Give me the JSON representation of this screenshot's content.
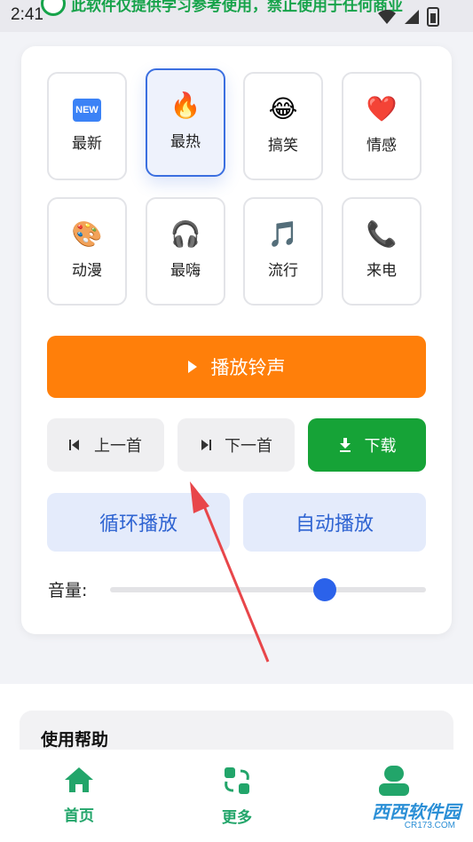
{
  "status_bar": {
    "time": "2:41",
    "notification_text": "此软件仅提供学习参考使用，禁止使用于任何商业"
  },
  "categories": [
    {
      "label": "最新",
      "emoji": "NEW",
      "icon": "new-icon",
      "selected": false
    },
    {
      "label": "最热",
      "emoji": "🔥",
      "icon": "fire-icon",
      "selected": true
    },
    {
      "label": "搞笑",
      "emoji": "😂",
      "icon": "laughing-face-icon",
      "selected": false
    },
    {
      "label": "情感",
      "emoji": "❤️",
      "icon": "heart-icon",
      "selected": false
    },
    {
      "label": "动漫",
      "emoji": "🎨",
      "icon": "palette-icon",
      "selected": false
    },
    {
      "label": "最嗨",
      "emoji": "🎧",
      "icon": "headphones-icon",
      "selected": false
    },
    {
      "label": "流行",
      "emoji": "🎵",
      "icon": "music-note-icon",
      "selected": false
    },
    {
      "label": "来电",
      "emoji": "📞",
      "icon": "phone-icon",
      "selected": false
    }
  ],
  "controls": {
    "play_label": "播放铃声",
    "prev_label": "上一首",
    "next_label": "下一首",
    "download_label": "下载",
    "loop_label": "循环播放",
    "auto_label": "自动播放",
    "volume_label": "音量:",
    "volume_level": 0.68
  },
  "help": {
    "title": "使用帮助"
  },
  "bottom_nav": [
    {
      "label": "首页",
      "icon": "home-icon"
    },
    {
      "label": "更多",
      "icon": "refresh-icon"
    },
    {
      "label": "",
      "icon": "user-icon"
    }
  ],
  "watermark": {
    "text": "西西软件园",
    "sub": "CR173.COM"
  },
  "colors": {
    "accent_orange": "#ff7f0a",
    "accent_green": "#16a337",
    "accent_blue": "#2b62ea",
    "nav_green": "#22a56a"
  }
}
